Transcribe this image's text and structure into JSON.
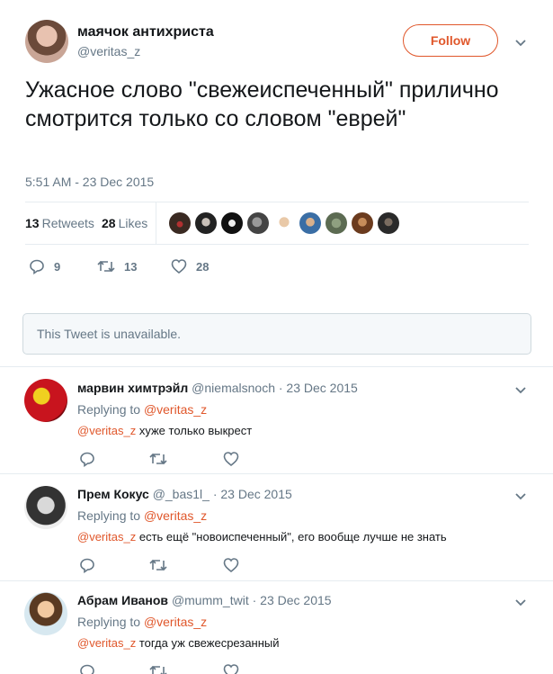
{
  "tweet": {
    "author_name": "маячок антихриста",
    "author_handle": "@veritas_z",
    "follow_label": "Follow",
    "text": "Ужасное слово \"свежеиспеченный\" прилично смотрится только со словом \"еврей\"",
    "time": "5:51 AM - 23 Dec 2015",
    "retweets_count": "13",
    "retweets_label": "Retweets",
    "likes_count": "28",
    "likes_label": "Likes",
    "replies": "9",
    "retweets": "13",
    "likes": "28"
  },
  "unavailable_text": "This Tweet is unavailable.",
  "accent_color": "#e0572b",
  "replies": [
    {
      "name": "марвин химтрэйл",
      "handle": "@niemalsnoch",
      "date": "· 23 Dec 2015",
      "replying_prefix": "Replying to",
      "replying_to": "@veritas_z",
      "mention": "@veritas_z",
      "text": "хуже только выкрест"
    },
    {
      "name": "Прем Кокус",
      "handle": "@_bas1l_",
      "date": "· 23 Dec 2015",
      "replying_prefix": "Replying to",
      "replying_to": "@veritas_z",
      "mention": "@veritas_z",
      "text": "есть ещё \"новоиспеченный\", его вообще лучше не знать"
    },
    {
      "name": "Абрам Иванов",
      "handle": "@mumm_twit",
      "date": "· 23 Dec 2015",
      "replying_prefix": "Replying to",
      "replying_to": "@veritas_z",
      "mention": "@veritas_z",
      "text": "тогда уж свежесрезанный"
    }
  ]
}
